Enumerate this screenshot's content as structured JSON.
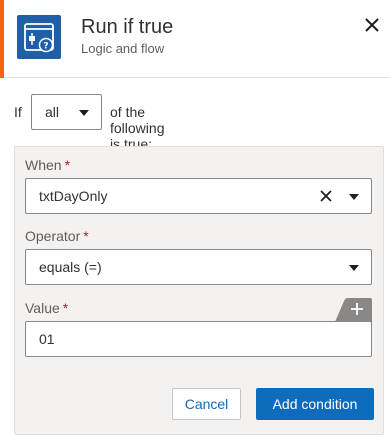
{
  "header": {
    "title": "Run if true",
    "subtitle": "Logic and flow",
    "icon": "condition-icon",
    "close_icon": "close-icon"
  },
  "condition_row": {
    "if_label": "If",
    "quantifier_value": "all",
    "suffix_label": "of the following is true:"
  },
  "condition": {
    "when": {
      "label": "When",
      "required_mark": "*",
      "value": "txtDayOnly"
    },
    "operator": {
      "label": "Operator",
      "required_mark": "*",
      "value": "equals (=)"
    },
    "value": {
      "label": "Value",
      "required_mark": "*",
      "value": "01"
    }
  },
  "actions": {
    "cancel_label": "Cancel",
    "add_label": "Add condition"
  },
  "colors": {
    "accent": "#f7630c",
    "icon_bg": "#1f5fa8",
    "primary": "#0f6cbd",
    "required": "#a4262c",
    "panel_bg": "#f3f2f1"
  }
}
